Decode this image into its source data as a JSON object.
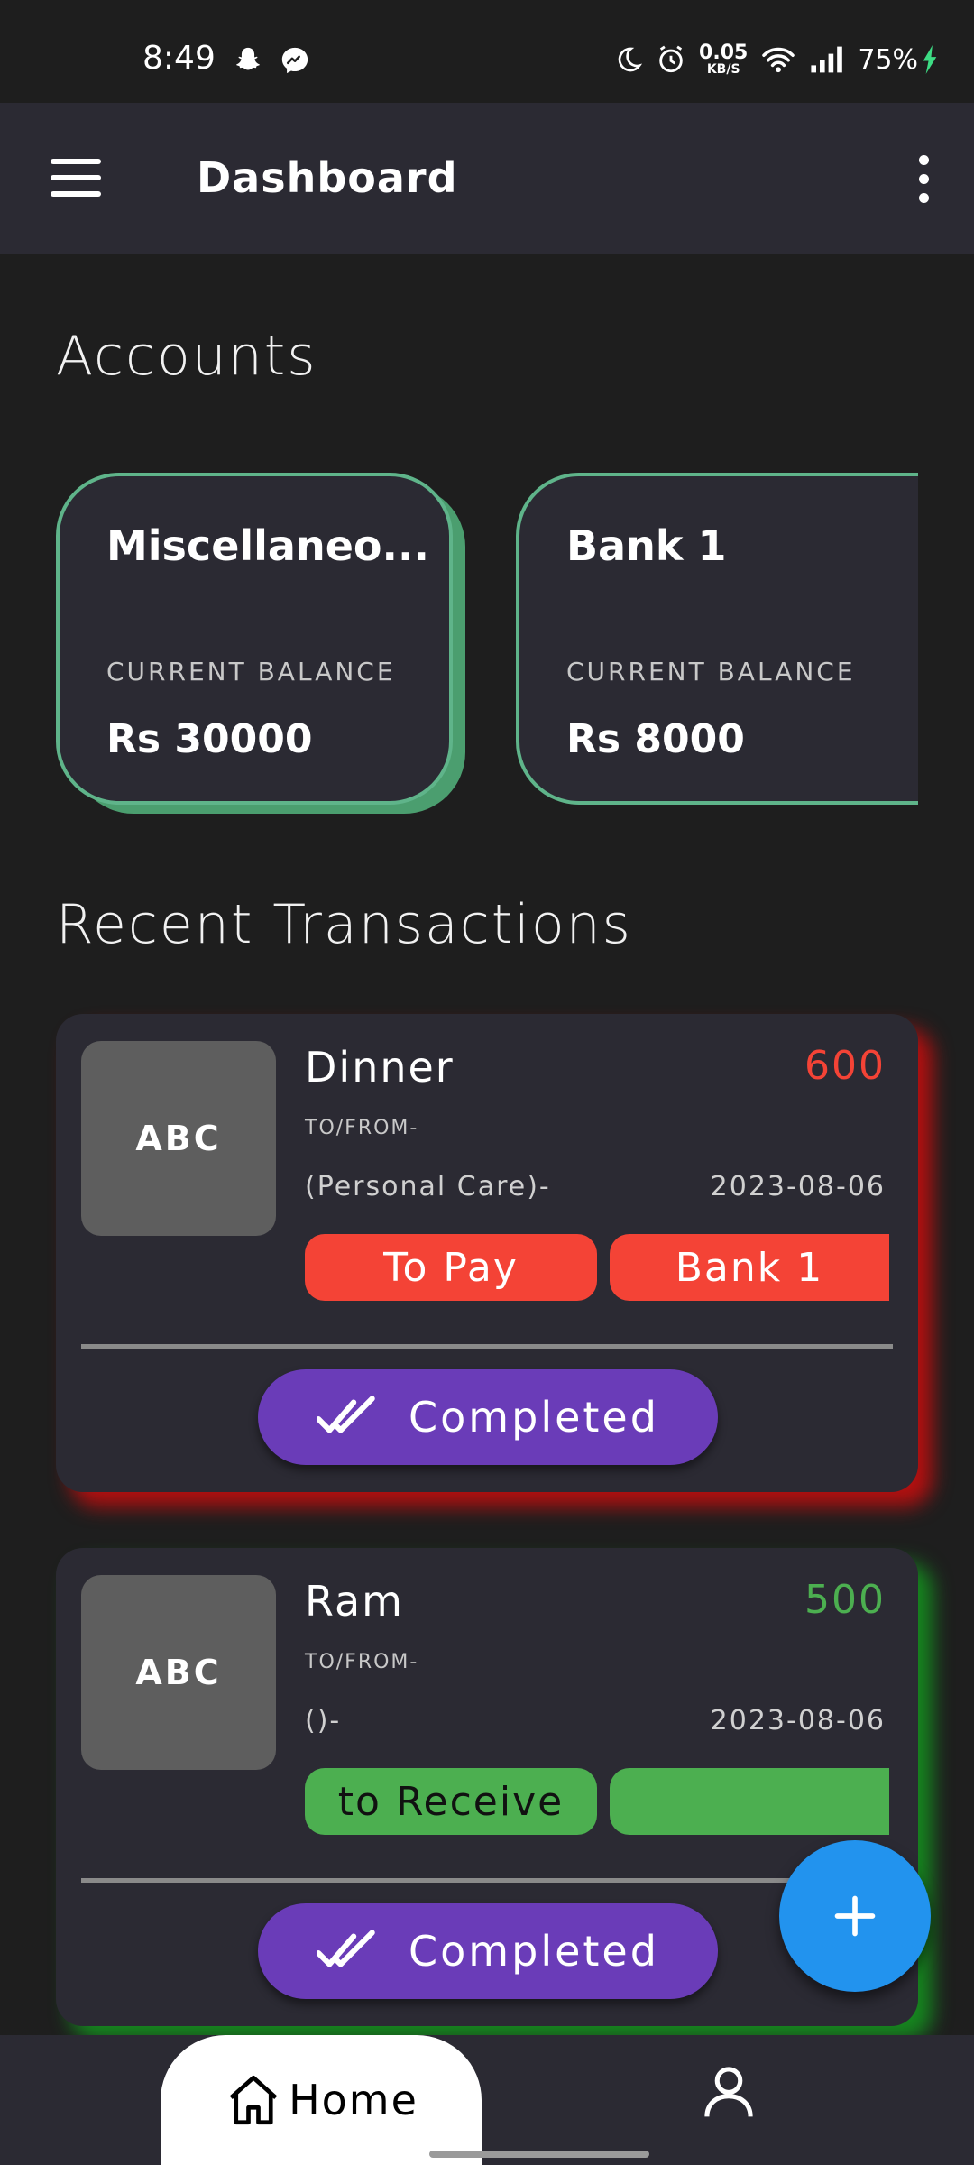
{
  "status_bar": {
    "time": "8:49",
    "data_speed_value": "0.05",
    "data_speed_unit": "KB/S",
    "battery": "75%"
  },
  "app_bar": {
    "title": "Dashboard"
  },
  "accounts": {
    "heading": "Accounts",
    "items": [
      {
        "name": "Miscellaneo...",
        "balance_label": "CURRENT BALANCE",
        "balance": "Rs 30000"
      },
      {
        "name": "Bank 1",
        "balance_label": "CURRENT BALANCE",
        "balance": "Rs 8000"
      }
    ]
  },
  "transactions": {
    "heading": "Recent Transactions",
    "items": [
      {
        "thumb": "ABC",
        "name": "Dinner",
        "amount": "600",
        "amount_color": "#f44336",
        "to_from": "TO/FROM-",
        "category": "(Personal Care)-",
        "date": "2023-08-06",
        "chip_type": "To Pay",
        "chip_account": "Bank 1",
        "chip_color": "#f44336",
        "status": "Completed"
      },
      {
        "thumb": "ABC",
        "name": "Ram",
        "amount": "500",
        "amount_color": "#4caf50",
        "to_from": "TO/FROM-",
        "category": "()-",
        "date": "2023-08-06",
        "chip_type": "to Receive",
        "chip_account": "",
        "chip_color": "#4caf50",
        "status": "Completed"
      }
    ]
  },
  "bottom_nav": {
    "home_label": "Home",
    "home_icon": "home-icon",
    "profile_icon": "person-icon"
  },
  "fab": {
    "icon": "plus-icon",
    "color": "#2293ee"
  }
}
